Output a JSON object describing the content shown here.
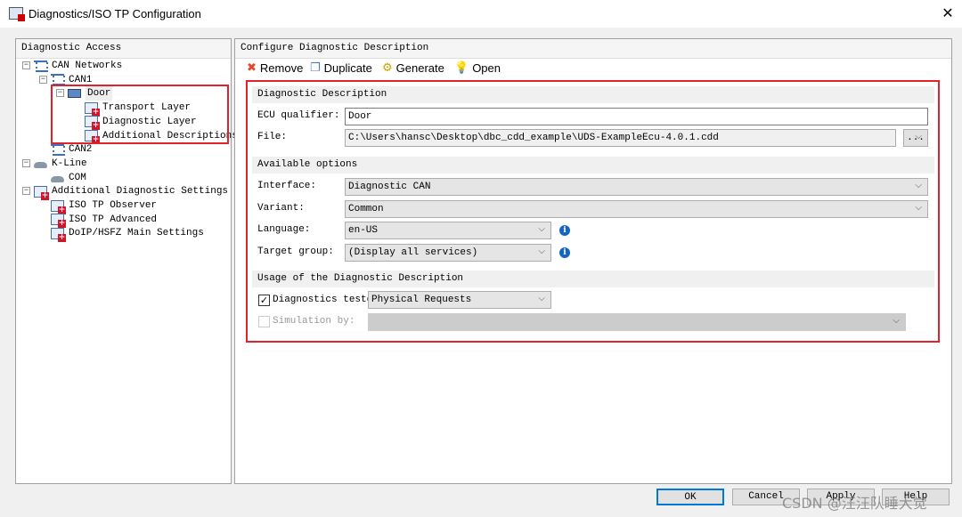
{
  "window": {
    "title": "Diagnostics/ISO TP Configuration",
    "close": "✕"
  },
  "left_panel": {
    "title": "Diagnostic Access",
    "tree": [
      {
        "label": "CAN Networks",
        "level": 0,
        "icon": "network-icon",
        "expanded": true
      },
      {
        "label": "CAN1",
        "level": 1,
        "icon": "network-icon",
        "expanded": true
      },
      {
        "label": "Door",
        "level": 2,
        "icon": "ecu-icon",
        "expanded": true,
        "selected": true
      },
      {
        "label": "Transport Layer",
        "level": 3,
        "icon": "settings-doc-icon"
      },
      {
        "label": "Diagnostic Layer",
        "level": 3,
        "icon": "settings-doc-icon"
      },
      {
        "label": "Additional Descriptions",
        "level": 3,
        "icon": "settings-doc-icon"
      },
      {
        "label": "CAN2",
        "level": 1,
        "icon": "network-icon"
      },
      {
        "label": "K-Line",
        "level": 0,
        "icon": "car-icon",
        "expanded": true
      },
      {
        "label": "COM",
        "level": 1,
        "icon": "car-icon"
      },
      {
        "label": "Additional Diagnostic Settings",
        "level": 0,
        "icon": "settings-doc-icon",
        "expanded": true
      },
      {
        "label": "ISO TP Observer",
        "level": 1,
        "icon": "settings-doc-icon"
      },
      {
        "label": "ISO TP Advanced",
        "level": 1,
        "icon": "settings-doc-icon"
      },
      {
        "label": "DoIP/HSFZ Main Settings",
        "level": 1,
        "icon": "settings-doc-icon"
      }
    ]
  },
  "right_panel": {
    "title": "Configure Diagnostic Description",
    "toolbar": {
      "remove": "Remove",
      "duplicate": "Duplicate",
      "generate": "Generate",
      "open": "Open"
    },
    "sections": {
      "description": "Diagnostic Description",
      "options": "Available options",
      "usage": "Usage of the Diagnostic Description"
    },
    "fields": {
      "ecu_label": "ECU qualifier:",
      "ecu_value": "Door",
      "file_label": "File:",
      "file_value": "C:\\Users\\hansc\\Desktop\\dbc_cdd_example\\UDS-ExampleEcu-4.0.1.cdd",
      "browse": "...",
      "interface_label": "Interface:",
      "interface_value": "Diagnostic CAN",
      "variant_label": "Variant:",
      "variant_value": "Common",
      "language_label": "Language:",
      "language_value": "en-US",
      "target_label": "Target group:",
      "target_value": "(Display all services)",
      "tester_label": "Diagnostics tester",
      "tester_checked": true,
      "tester_value": "Physical Requests",
      "simulation_label": "Simulation by:",
      "simulation_checked": false,
      "simulation_value": ""
    }
  },
  "buttons": {
    "ok": "OK",
    "cancel": "Cancel",
    "apply": "Apply",
    "help": "Help"
  },
  "watermark": "CSDN @汪汪队睡大觉",
  "colors": {
    "highlight_box": "#e0222c",
    "ok_border": "#0078d7"
  }
}
